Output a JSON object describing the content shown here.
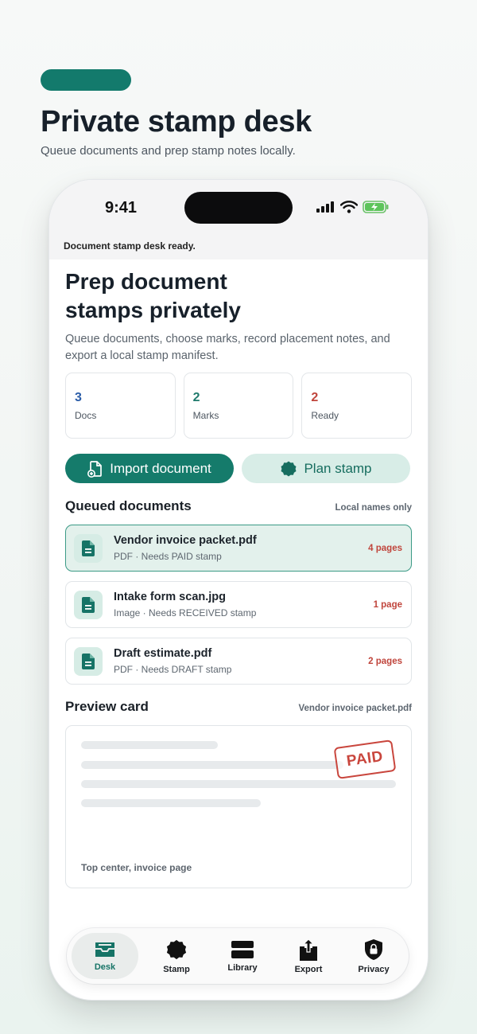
{
  "header": {
    "title": "Private stamp desk",
    "subtitle": "Queue documents and prep stamp notes locally."
  },
  "status_bar": {
    "time": "9:41"
  },
  "banner": "Document stamp desk ready.",
  "main": {
    "title": "Prep document stamps privately",
    "description": "Queue documents, choose marks, record placement notes, and export a local stamp manifest."
  },
  "stats": [
    {
      "value": "3",
      "label": "Docs",
      "color": "#2b5da8"
    },
    {
      "value": "2",
      "label": "Marks",
      "color": "#1f7a6c"
    },
    {
      "value": "2",
      "label": "Ready",
      "color": "#c0453c"
    }
  ],
  "actions": {
    "import_label": "Import document",
    "plan_label": "Plan stamp"
  },
  "queue": {
    "title": "Queued documents",
    "note": "Local names only",
    "items": [
      {
        "name": "Vendor invoice packet.pdf",
        "meta": "PDF · Needs PAID stamp",
        "pages": "4 pages"
      },
      {
        "name": "Intake form scan.jpg",
        "meta": "Image · Needs RECEIVED stamp",
        "pages": "1 page"
      },
      {
        "name": "Draft estimate.pdf",
        "meta": "PDF · Needs DRAFT stamp",
        "pages": "2 pages"
      }
    ]
  },
  "preview": {
    "title": "Preview card",
    "file": "Vendor invoice packet.pdf",
    "stamp_text": "PAID",
    "placement": "Top center, invoice page"
  },
  "tabs": [
    {
      "label": "Desk",
      "icon": "tray-icon"
    },
    {
      "label": "Stamp",
      "icon": "seal-icon"
    },
    {
      "label": "Library",
      "icon": "library-icon"
    },
    {
      "label": "Export",
      "icon": "share-icon"
    },
    {
      "label": "Privacy",
      "icon": "lock-shield-icon"
    }
  ],
  "colors": {
    "brand": "#157b6b",
    "brand_light": "#d8ede7",
    "alert": "#c0453c"
  }
}
